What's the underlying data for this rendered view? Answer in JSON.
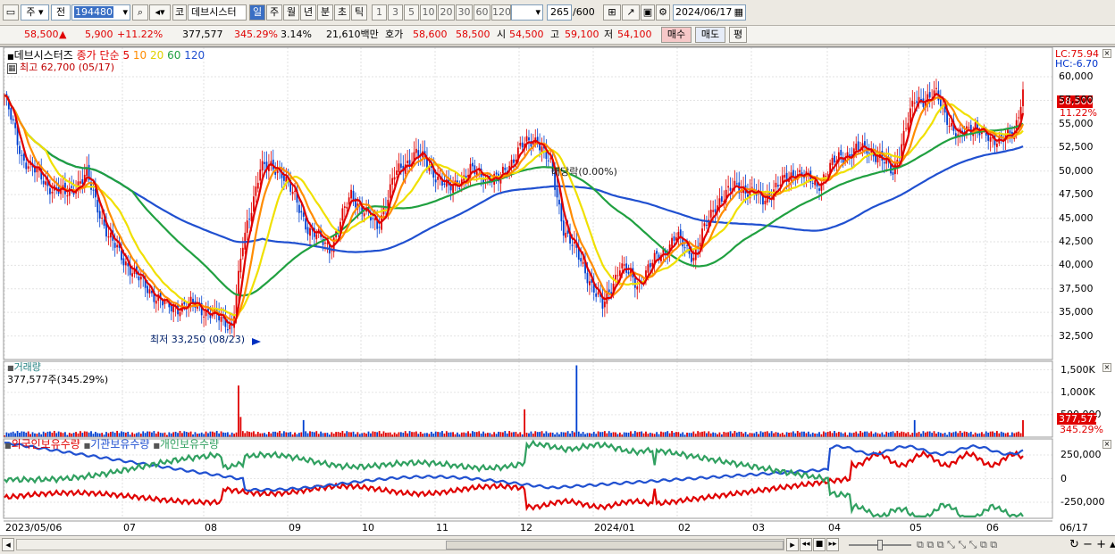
{
  "toolbar": {
    "period_unit": "주",
    "prev_label": "전",
    "code": "194480",
    "code_prefix": "코",
    "stock_name": "데브시스터",
    "periods": [
      "일",
      "주",
      "월",
      "년",
      "분",
      "초",
      "틱"
    ],
    "active_period": "일",
    "intervals": [
      "1",
      "3",
      "5",
      "10",
      "20",
      "30",
      "60",
      "120"
    ],
    "count": "265",
    "count_max": "/600",
    "date": "2024/06/17"
  },
  "quote": {
    "price": "58,500",
    "change": "5,900",
    "change_pct": "+11.22%",
    "volume": "377,577",
    "vol_ratio": "345.29%",
    "turnover": "3.14%",
    "amount": "21,610백만",
    "ask_label": "호가",
    "ask": "58,600",
    "bid": "58,500",
    "open_label": "시",
    "open": "54,500",
    "high_label": "고",
    "high": "59,100",
    "low_label": "저",
    "low": "54,100",
    "buy_label": "매수",
    "sell_label": "매도",
    "eval_label": "평"
  },
  "price_panel": {
    "legend_name": "데브시스터즈",
    "legend_ma_label": "종가 단순",
    "ma_periods": [
      "5",
      "10",
      "20",
      "60",
      "120"
    ],
    "high_note": "최고 62,700 (05/17)",
    "low_note": "최저 33,250 (08/23)",
    "dividend_note": "배당락(0.00%)",
    "lc": "LC:75.94",
    "hc": "HC:-6.70",
    "last_price_tag": "58,500",
    "last_pct_tag": "11.22%",
    "y_ticks": [
      "60,000",
      "57,500",
      "55,000",
      "52,500",
      "50,000",
      "47,500",
      "45,000",
      "42,500",
      "40,000",
      "37,500",
      "35,000",
      "32,500"
    ]
  },
  "volume_panel": {
    "title": "거래량",
    "readout": "377,577주(345.29%)",
    "y_ticks": [
      "1,500K",
      "1,000K",
      "500,000"
    ],
    "last_tag": "377,577",
    "last_pct_tag": "345.29%"
  },
  "holdings_panel": {
    "legend": [
      "외국인보유수량",
      "기관보유수량",
      "개인보유수량"
    ],
    "y_ticks": [
      "250,000",
      "0",
      "-250,000"
    ]
  },
  "x_axis": {
    "labels": [
      "2023/05/06",
      "07",
      "08",
      "09",
      "10",
      "11",
      "12",
      "2024/01",
      "02",
      "03",
      "04",
      "05",
      "06"
    ],
    "right_label": "06/17"
  },
  "colors": {
    "up": "#e00000",
    "down": "#0040d0",
    "ma5": "#e00000",
    "ma10": "#ff8c00",
    "ma20": "#f0e000",
    "ma60": "#20a040",
    "ma120": "#2050d0",
    "foreign": "#e00000",
    "institution": "#2050d0",
    "individual": "#30a060"
  }
}
